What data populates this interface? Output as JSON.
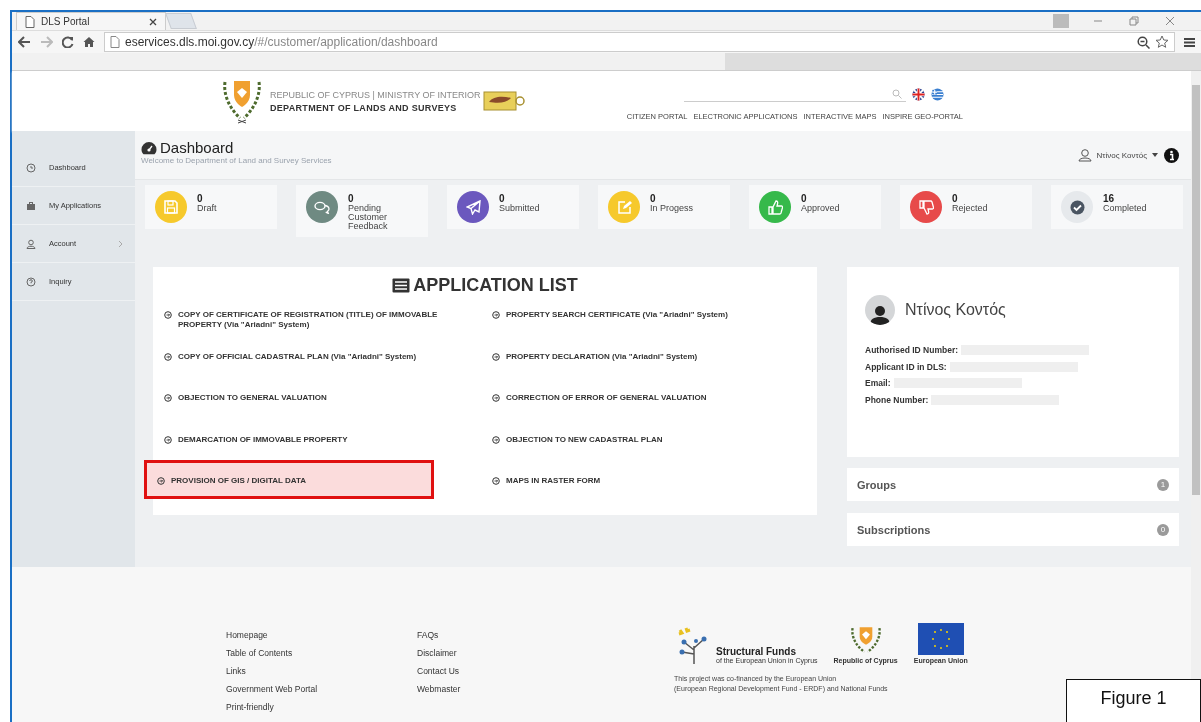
{
  "browser": {
    "tab_title": "DLS Portal",
    "url_host": "eservices.dls.moi.gov.cy",
    "url_path": "/#/customer/application/dashboard"
  },
  "header": {
    "line1": "REPUBLIC OF CYPRUS | MINISTRY OF INTERIOR",
    "line2": "DEPARTMENT OF LANDS AND SURVEYS",
    "nav": [
      "CITIZEN PORTAL",
      "ELECTRONIC APPLICATIONS",
      "INTERACTIVE MAPS",
      "INSPIRE GEO-PORTAL"
    ]
  },
  "sidebar": {
    "items": [
      {
        "label": "Dashboard",
        "kind": "clock",
        "has_arrow": false
      },
      {
        "label": "My Applications",
        "kind": "briefcase",
        "has_arrow": false
      },
      {
        "label": "Account",
        "kind": "user",
        "has_arrow": true
      },
      {
        "label": "Inquiry",
        "kind": "question",
        "has_arrow": false
      }
    ]
  },
  "page": {
    "title": "Dashboard",
    "subtitle": "Welcome to Department of Land and Survey Services",
    "user": "Ντίνος Κοντός"
  },
  "stats": [
    {
      "count": "0",
      "label": "Draft",
      "kind": "save",
      "color": "#f6c92c"
    },
    {
      "count": "0",
      "label": "Pending Customer Feedback",
      "kind": "chat",
      "color": "#6f8a82"
    },
    {
      "count": "0",
      "label": "Submitted",
      "kind": "send",
      "color": "#6b58be"
    },
    {
      "count": "0",
      "label": "In Progess",
      "kind": "edit",
      "color": "#f6c92c"
    },
    {
      "count": "0",
      "label": "Approved",
      "kind": "thumbs-up",
      "color": "#36b94b"
    },
    {
      "count": "0",
      "label": "Rejected",
      "kind": "thumbs-down",
      "color": "#e74a4a"
    },
    {
      "count": "16",
      "label": "Completed",
      "kind": "check",
      "color": "#e6e9ec"
    }
  ],
  "application_list": {
    "title": "APPLICATION LIST",
    "items": [
      {
        "label": "COPY OF CERTIFICATE OF REGISTRATION (TITLE) OF IMMOVABLE PROPERTY (Via \"Ariadni\" System)",
        "highlighted": false
      },
      {
        "label": "PROPERTY SEARCH CERTIFICATE (Via \"Ariadni\" System)",
        "highlighted": false
      },
      {
        "label": "COPY OF OFFICIAL CADASTRAL PLAN (Via \"Ariadni\" System)",
        "highlighted": false
      },
      {
        "label": "PROPERTY DECLARATION (Via \"Ariadni\" System)",
        "highlighted": false
      },
      {
        "label": "OBJECTION TO GENERAL VALUATION",
        "highlighted": false
      },
      {
        "label": "CORRECTION OF ERROR OF GENERAL VALUATION",
        "highlighted": false
      },
      {
        "label": "DEMARCATION OF IMMOVABLE PROPERTY",
        "highlighted": false
      },
      {
        "label": "OBJECTION TO NEW CADASTRAL PLAN",
        "highlighted": false
      },
      {
        "label": "PROVISION OF GIS / DIGITAL DATA",
        "highlighted": true
      },
      {
        "label": "MAPS IN RASTER FORM",
        "highlighted": false
      }
    ]
  },
  "profile": {
    "name": "Ντίνος Κοντός",
    "fields": [
      "Authorised ID Number:",
      "Applicant ID in DLS:",
      "Email:",
      "Phone Number:"
    ]
  },
  "panels": [
    {
      "title": "Groups",
      "badge": "1"
    },
    {
      "title": "Subscriptions",
      "badge": "0"
    }
  ],
  "footer": {
    "links_col1": [
      "Homepage",
      "Table of Contents",
      "Links",
      "Government Web Portal",
      "Print-friendly"
    ],
    "links_col2": [
      "FAQs",
      "Disclaimer",
      "Contact Us",
      "Webmaster"
    ],
    "logo1_title": "Structural Funds",
    "logo1_sub": "of the European Union in Cyprus",
    "logo2": "Republic of Cyprus",
    "logo3": "European Union",
    "cofinance": [
      "This project was co-financed by the European Union",
      "(European Regional Development Fund - ERDF) and National Funds"
    ]
  },
  "caption": "Figure 1"
}
